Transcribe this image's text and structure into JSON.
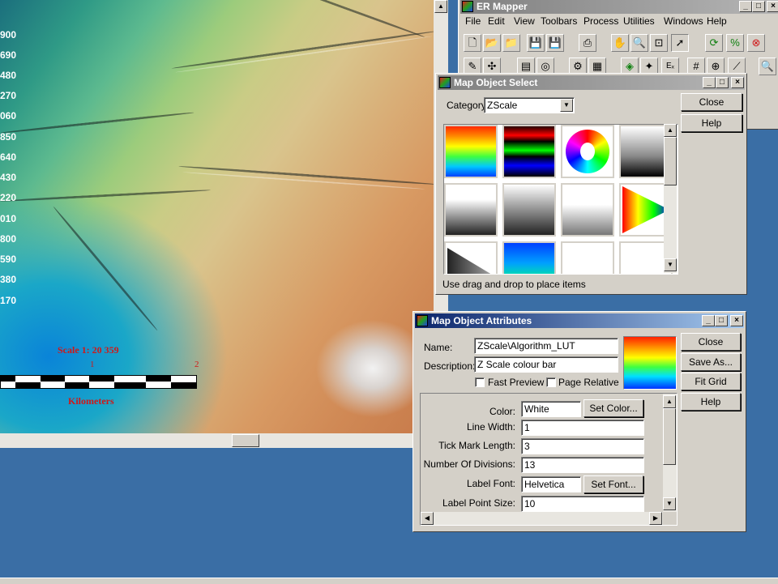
{
  "map": {
    "y_labels": [
      "900",
      "690",
      "480",
      "270",
      "060",
      "850",
      "640",
      "430",
      "220",
      "010",
      "800",
      "590",
      "380",
      "170"
    ],
    "scale_title": "Scale 1: 20 359",
    "scale_tick_1": "1",
    "scale_tick_2": "2",
    "scale_units": "Kilometers"
  },
  "ermapper": {
    "title": "ER Mapper",
    "menus": [
      "File",
      "Edit",
      "View",
      "Toolbars",
      "Process",
      "Utilities",
      "Windows",
      "Help"
    ],
    "toolbar1_icons": [
      "new-icon",
      "open-icon",
      "open-folder-icon",
      "save-icon",
      "save-as-icon",
      "print-icon",
      "pan-hand-icon",
      "zoom-icon",
      "zoom-box-icon",
      "pointer-icon",
      "refresh-icon",
      "stats-icon",
      "stop-icon"
    ],
    "toolbar2_icons": [
      "edit-icon",
      "crosshair-icon",
      "layers-icon",
      "wizard-icon",
      "algorithm-icon",
      "histogram-icon",
      "grid-icon",
      "target-icon",
      "graph-icon",
      "search-icon"
    ]
  },
  "map_object_select": {
    "title": "Map Object Select",
    "category_label": "Category:",
    "category_value": "ZScale",
    "close_label": "Close",
    "help_label": "Help",
    "status": "Use drag and drop to place items",
    "tiles": [
      "rainbow-lut",
      "rgb-bands-lut",
      "color-wheel-lut",
      "gray-gradient-lut",
      "white-gray-lut",
      "gray-lut",
      "gray-fade-lut",
      "spectrum-triangle-lut",
      "gray-triangle-lut",
      "blue-green-lut",
      "white-blue-lut",
      "white-blue-fade-lut"
    ]
  },
  "map_object_attributes": {
    "title": "Map Object Attributes",
    "name_label": "Name:",
    "name_value": "ZScale\\Algorithm_LUT",
    "description_label": "Description:",
    "description_value": "Z Scale colour bar",
    "fast_preview_label": "Fast Preview",
    "page_relative_label": "Page Relative",
    "close_label": "Close",
    "save_as_label": "Save As...",
    "fit_grid_label": "Fit Grid",
    "help_label": "Help",
    "color_label": "Color:",
    "color_value": "White",
    "set_color_label": "Set Color...",
    "line_width_label": "Line Width:",
    "line_width_value": "1",
    "tick_mark_length_label": "Tick Mark Length:",
    "tick_mark_length_value": "3",
    "number_of_divisions_label": "Number Of Divisions:",
    "number_of_divisions_value": "13",
    "label_font_label": "Label Font:",
    "label_font_value": "Helvetica",
    "set_font_label": "Set Font...",
    "label_point_size_label": "Label Point Size:",
    "label_point_size_value": "10"
  },
  "colors": {
    "desktop": "#3a6ea5",
    "scale_text": "#d01818",
    "active_title": "#0a246a"
  }
}
